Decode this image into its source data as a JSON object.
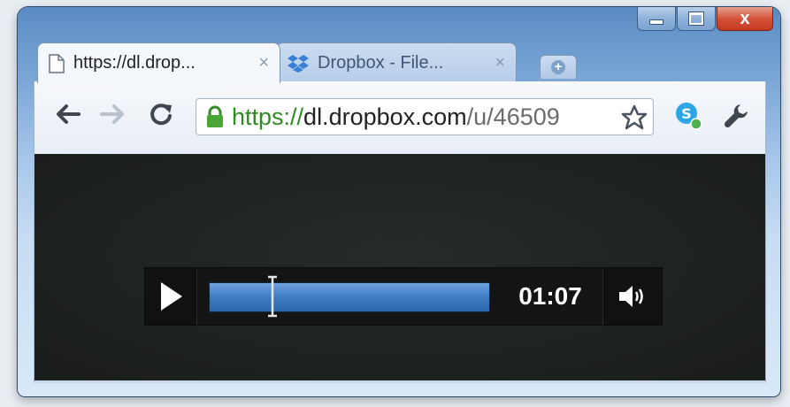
{
  "window": {
    "buttons": {
      "minimize": "minimize",
      "maximize": "maximize",
      "close": "x"
    }
  },
  "tabs": [
    {
      "label": "https://dl.drop...",
      "close": "×",
      "icon": "page-icon",
      "active": true
    },
    {
      "label": "Dropbox - File...",
      "close": "×",
      "icon": "dropbox-icon",
      "active": false
    }
  ],
  "new_tab": {
    "icon": "new-tab-icon",
    "label": "+"
  },
  "toolbar": {
    "back_icon": "back-arrow-icon",
    "forward_icon": "forward-arrow-icon",
    "reload_icon": "reload-icon",
    "url": {
      "scheme": "https://",
      "host": "dl.dropbox.com",
      "path": "/u/46509"
    },
    "bookmark_icon": "star-icon",
    "extension_icon": "skype-extension-icon",
    "menu_icon": "wrench-icon"
  },
  "player": {
    "play_icon": "play-icon",
    "time": "01:07",
    "progress": 0.25,
    "volume_icon": "volume-icon"
  },
  "colors": {
    "progress_fill": "#3f7fc6",
    "url_scheme": "#2e8b22",
    "content_bg": "#1e2220"
  }
}
